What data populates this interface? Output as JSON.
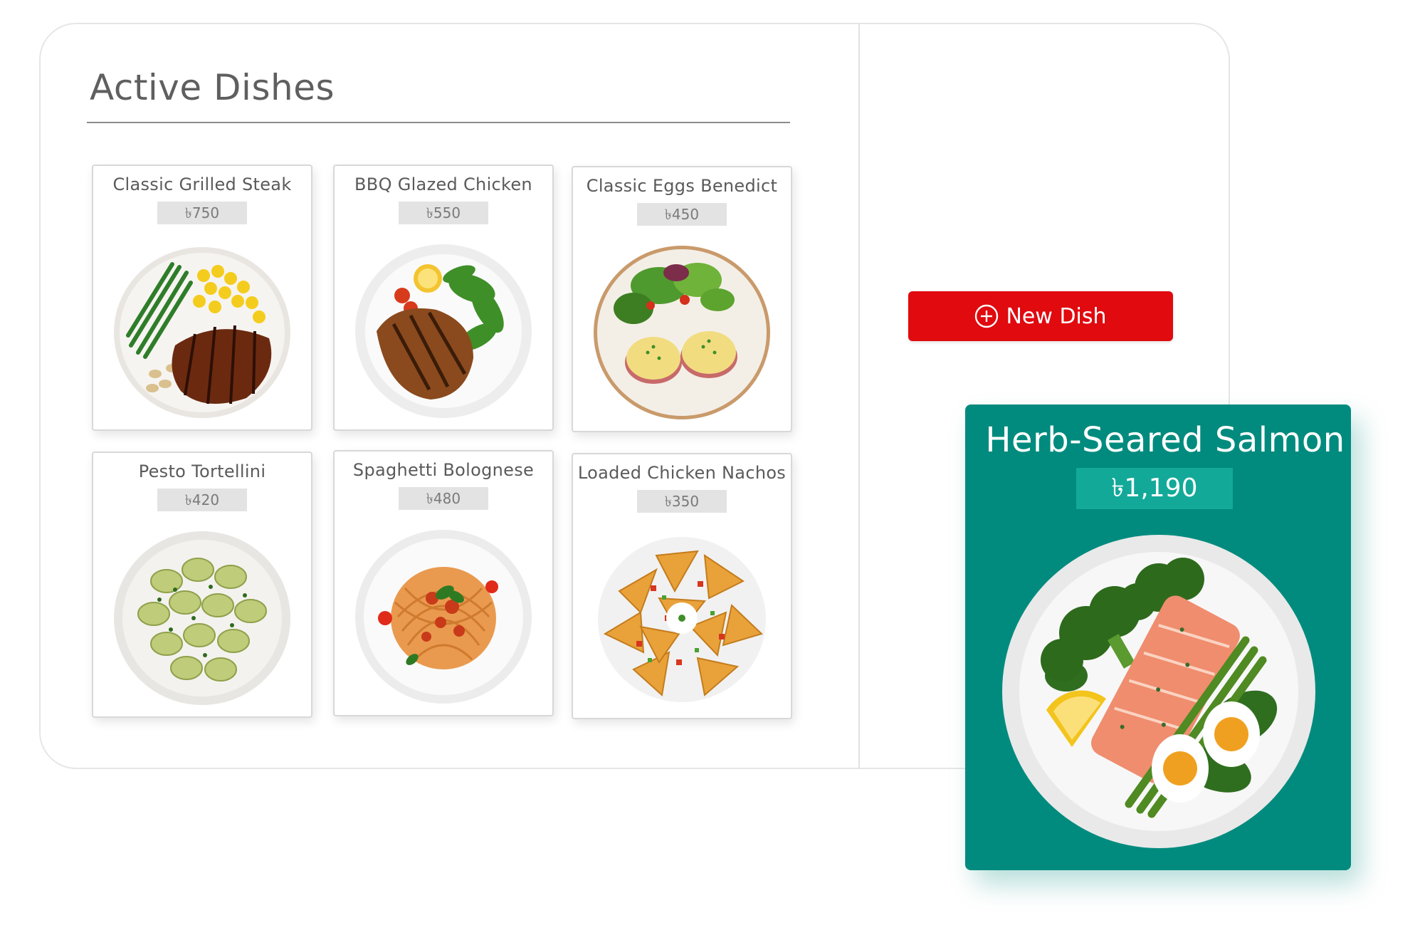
{
  "section": {
    "title": "Active Dishes"
  },
  "dishes": [
    {
      "name": "Classic Grilled Steak",
      "price": "৳750",
      "icon": "steak-plate-image"
    },
    {
      "name": "BBQ Glazed Chicken",
      "price": "৳550",
      "icon": "chicken-plate-image"
    },
    {
      "name": "Classic Eggs Benedict",
      "price": "৳450",
      "icon": "eggs-benedict-plate-image"
    },
    {
      "name": "Pesto Tortellini",
      "price": "৳420",
      "icon": "tortellini-bowl-image"
    },
    {
      "name": "Spaghetti Bolognese",
      "price": "৳480",
      "icon": "spaghetti-plate-image"
    },
    {
      "name": "Loaded Chicken Nachos",
      "price": "৳350",
      "icon": "nachos-plate-image"
    }
  ],
  "actions": {
    "new_dish_label": "New Dish",
    "new_dish_icon": "plus-circle-icon"
  },
  "featured": {
    "name": "Herb-Seared Salmon",
    "price": "৳1,190",
    "icon": "salmon-plate-image"
  },
  "colors": {
    "accent_red": "#e00a0f",
    "featured_teal": "#008b7e",
    "featured_price_bg": "#12a998",
    "price_chip_bg": "#e3e3e3"
  }
}
